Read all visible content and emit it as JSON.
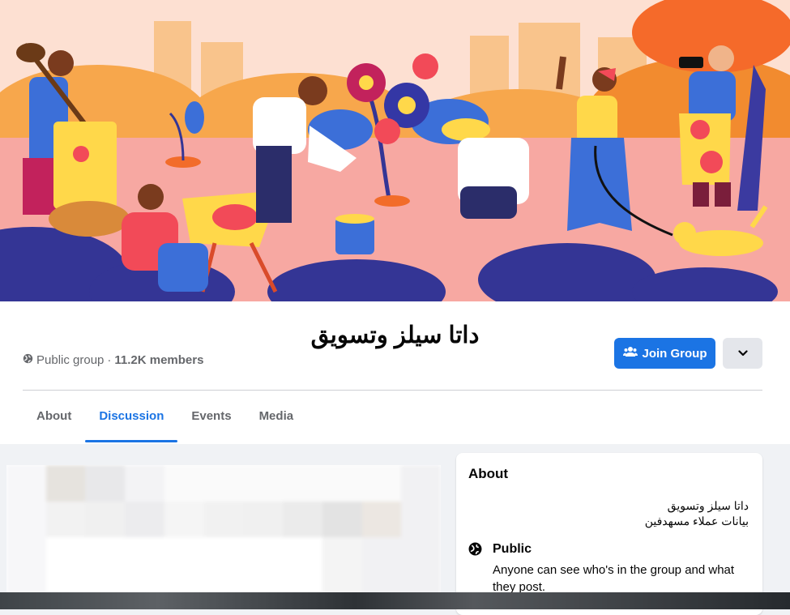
{
  "group": {
    "name": "داتا سيلز وتسويق",
    "privacy_label": "Public group",
    "separator": " · ",
    "member_count": "11.2K members"
  },
  "actions": {
    "join_label": "Join Group"
  },
  "tabs": [
    {
      "label": "About",
      "active": false
    },
    {
      "label": "Discussion",
      "active": true
    },
    {
      "label": "Events",
      "active": false
    },
    {
      "label": "Media",
      "active": false
    }
  ],
  "about": {
    "title": "About",
    "description_line1": "داتا سيلز وتسويق",
    "description_line2": "بيانات عملاء مسهدفين",
    "privacy_title": "Public",
    "privacy_text": "Anyone can see who's in the group and what they post."
  },
  "colors": {
    "accent": "#1b74e4",
    "cover_background": "#f7a8a2",
    "page_background": "#f0f2f5"
  },
  "icons": {
    "globe": "globe-icon",
    "members": "members-icon",
    "chevron": "chevron-down-icon"
  }
}
